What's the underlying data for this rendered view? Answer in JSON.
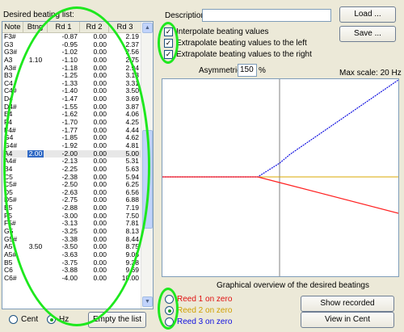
{
  "list_title": "Desired beating list:",
  "columns": [
    "Note",
    "Btng",
    "Rd 1",
    "Rd 2",
    "Rd 3"
  ],
  "rows": [
    [
      "F3#",
      "",
      "-0.87",
      "0.00",
      "2.19"
    ],
    [
      "G3",
      "",
      "-0.95",
      "0.00",
      "2.37"
    ],
    [
      "G3#",
      "",
      "-1.02",
      "0.00",
      "2.56"
    ],
    [
      "A3",
      "1.10",
      "-1.10",
      "0.00",
      "2.75"
    ],
    [
      "A3#",
      "",
      "-1.18",
      "0.00",
      "2.94"
    ],
    [
      "B3",
      "",
      "-1.25",
      "0.00",
      "3.13"
    ],
    [
      "C4",
      "",
      "-1.33",
      "0.00",
      "3.31"
    ],
    [
      "C4#",
      "",
      "-1.40",
      "0.00",
      "3.50"
    ],
    [
      "D4",
      "",
      "-1.47",
      "0.00",
      "3.69"
    ],
    [
      "D4#",
      "",
      "-1.55",
      "0.00",
      "3.87"
    ],
    [
      "E4",
      "",
      "-1.62",
      "0.00",
      "4.06"
    ],
    [
      "F4",
      "",
      "-1.70",
      "0.00",
      "4.25"
    ],
    [
      "F4#",
      "",
      "-1.77",
      "0.00",
      "4.44"
    ],
    [
      "G4",
      "",
      "-1.85",
      "0.00",
      "4.62"
    ],
    [
      "G4#",
      "",
      "-1.92",
      "0.00",
      "4.81"
    ],
    [
      "A4",
      "2.00",
      "-2.00",
      "0.00",
      "5.00"
    ],
    [
      "A4#",
      "",
      "-2.13",
      "0.00",
      "5.31"
    ],
    [
      "B4",
      "",
      "-2.25",
      "0.00",
      "5.63"
    ],
    [
      "C5",
      "",
      "-2.38",
      "0.00",
      "5.94"
    ],
    [
      "C5#",
      "",
      "-2.50",
      "0.00",
      "6.25"
    ],
    [
      "D5",
      "",
      "-2.63",
      "0.00",
      "6.56"
    ],
    [
      "D5#",
      "",
      "-2.75",
      "0.00",
      "6.88"
    ],
    [
      "E5",
      "",
      "-2.88",
      "0.00",
      "7.19"
    ],
    [
      "F5",
      "",
      "-3.00",
      "0.00",
      "7.50"
    ],
    [
      "F5#",
      "",
      "-3.13",
      "0.00",
      "7.81"
    ],
    [
      "G5",
      "",
      "-3.25",
      "0.00",
      "8.13"
    ],
    [
      "G5#",
      "",
      "-3.38",
      "0.00",
      "8.44"
    ],
    [
      "A5",
      "3.50",
      "-3.50",
      "0.00",
      "8.75"
    ],
    [
      "A5#",
      "",
      "-3.63",
      "0.00",
      "9.06"
    ],
    [
      "B5",
      "",
      "-3.75",
      "0.00",
      "9.38"
    ],
    [
      "C6",
      "",
      "-3.88",
      "0.00",
      "9.69"
    ],
    [
      "C6#",
      "",
      "-4.00",
      "0.00",
      "10.00"
    ]
  ],
  "selected_row_index": 15,
  "unit_cent": "Cent",
  "unit_hz": "Hz",
  "empty_button": "Empty the list",
  "description_label": "Description:",
  "description_value": "",
  "load_button": "Load ...",
  "save_button": "Save ...",
  "checkboxes": [
    {
      "label": "Interpolate beating values",
      "checked": true
    },
    {
      "label": "Extrapolate beating values to the left",
      "checked": true
    },
    {
      "label": "Extrapolate beating values to the right",
      "checked": true
    }
  ],
  "asymmetricity_label": "Asymmetricity",
  "asymmetricity_value": "150",
  "asymmetricity_unit": "%",
  "max_scale": "Max scale: 20 Hz",
  "graph_caption": "Graphical overview of the desired beatings",
  "reed_options": [
    {
      "label": "Reed 1 on zero",
      "color": "#e01010",
      "selected": false
    },
    {
      "label": "Reed 2 on zero",
      "color": "#d0a000",
      "selected": true
    },
    {
      "label": "Reed 3 on zero",
      "color": "#1010e0",
      "selected": false
    }
  ],
  "show_recorded_button": "Show recorded",
  "view_cent_button": "View in Cent",
  "colors": {
    "reed1": "#ff2020",
    "reed2": "#d8a800",
    "reed3": "#1010e0",
    "highlight": "#1ee81e"
  }
}
